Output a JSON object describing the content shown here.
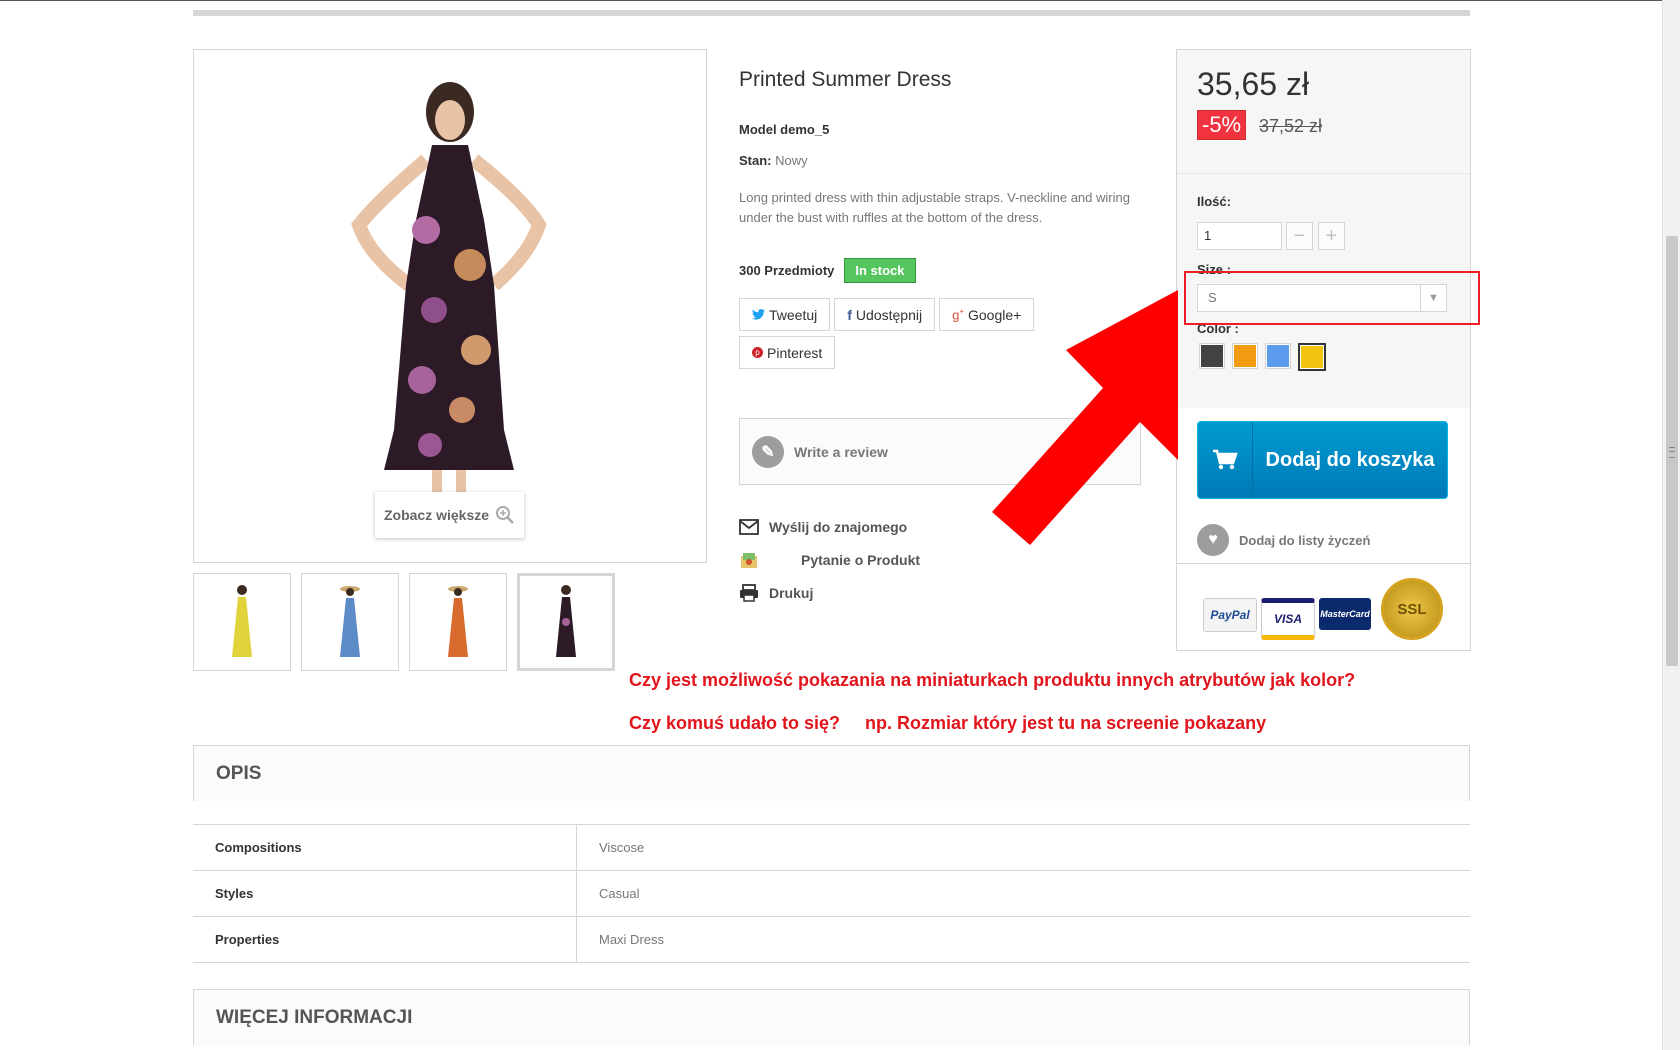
{
  "product": {
    "title": "Printed Summer Dress",
    "model": "Model demo_5",
    "stan_label": "Stan:",
    "stan_value": "Nowy",
    "description": "Long printed dress with thin adjustable straps. V-neckline and wiring under the bust with ruffles at the bottom of the dress.",
    "quantity_text": "300 Przedmioty",
    "stock_badge": "In stock",
    "zoom_label": "Zobacz większe"
  },
  "social": {
    "tweet": "Tweetuj",
    "facebook": "Udostępnij",
    "google": "Google+",
    "pinterest": "Pinterest"
  },
  "review": {
    "label": "Write a review"
  },
  "links": {
    "send": "Wyślij do znajomego",
    "question": "Pytanie o Produkt",
    "print": "Drukuj"
  },
  "buybox": {
    "price": "35,65 zł",
    "discount": "-5%",
    "old_price": "37,52 zł",
    "qty_label": "Ilość:",
    "qty_value": "1",
    "size_label": "Size :",
    "size_value": "S",
    "color_label": "Color :",
    "colors": [
      "#434343",
      "#f39c11",
      "#5d9cec",
      "#f1c40f"
    ],
    "selected_color_index": 3,
    "cart_button": "Dodaj do koszyka",
    "wishlist": "Dodaj do listy życzeń",
    "payments": [
      "PayPal",
      "VISA",
      "MasterCard",
      "SSL"
    ]
  },
  "annotation": {
    "line1": "Czy jest możliwość pokazania na miniaturkach produktu innych atrybutów jak kolor?",
    "line2": "Czy komuś udało to się?     np. Rozmiar który jest tu na screenie pokazany",
    "color": "#e2151c"
  },
  "sections": {
    "opis": "OPIS",
    "more_info": "WIĘCEJ INFORMACJI"
  },
  "features": [
    {
      "name": "Compositions",
      "value": "Viscose"
    },
    {
      "name": "Styles",
      "value": "Casual"
    },
    {
      "name": "Properties",
      "value": "Maxi Dress"
    }
  ]
}
